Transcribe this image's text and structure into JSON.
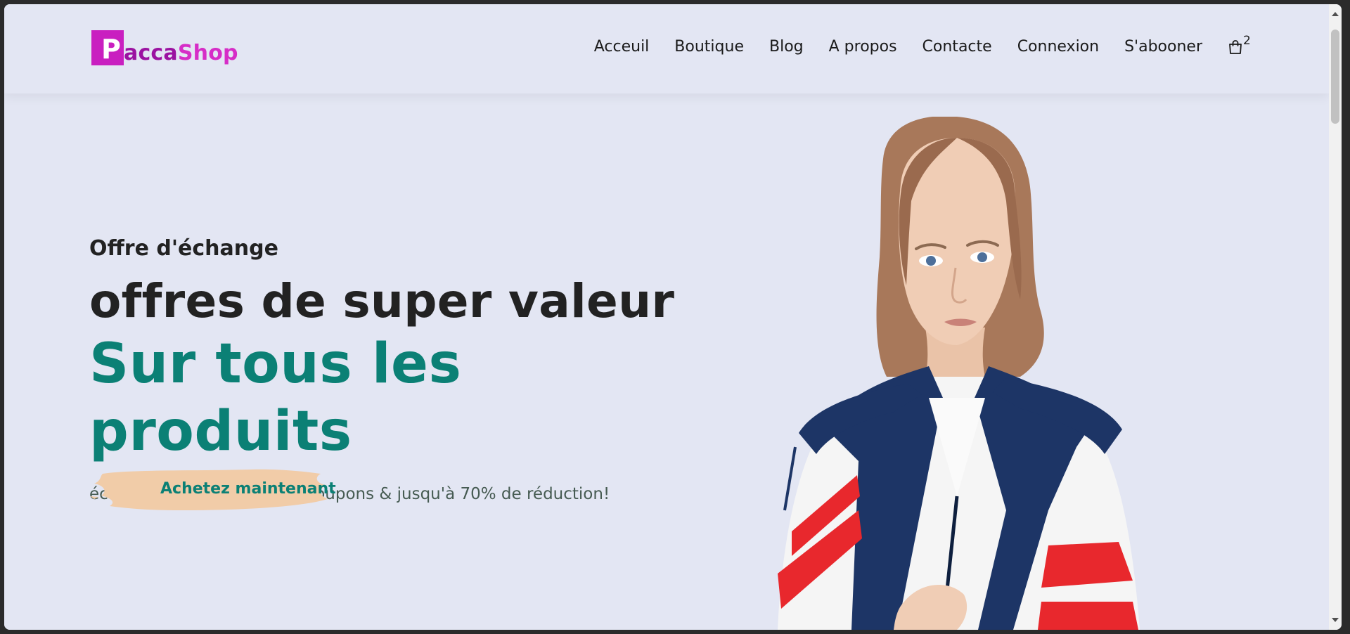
{
  "header": {
    "logo": {
      "letter": "P",
      "text_part1": "acca",
      "text_part2": "Shop"
    },
    "nav": {
      "items": [
        {
          "label": "Acceuil"
        },
        {
          "label": "Boutique"
        },
        {
          "label": "Blog"
        },
        {
          "label": "A propos"
        },
        {
          "label": "Contacte"
        },
        {
          "label": "Connexion"
        },
        {
          "label": "S'abooner"
        }
      ],
      "cart_count": "2",
      "cart_icon": "shopping-bag-icon"
    }
  },
  "hero": {
    "eyebrow": "Offre d'échange",
    "headline": "offres de super valeur",
    "headline_accent": "Sur tous les produits",
    "subtext": "économisez plus avec des coupons & jusqu'à 70% de réduction!",
    "cta_label": "Achetez maintenant"
  },
  "colors": {
    "page_background": "#e3e6f3",
    "accent_teal": "#0b8075",
    "logo_magenta": "#c91fc0",
    "cta_brush": "#f1cca8"
  }
}
